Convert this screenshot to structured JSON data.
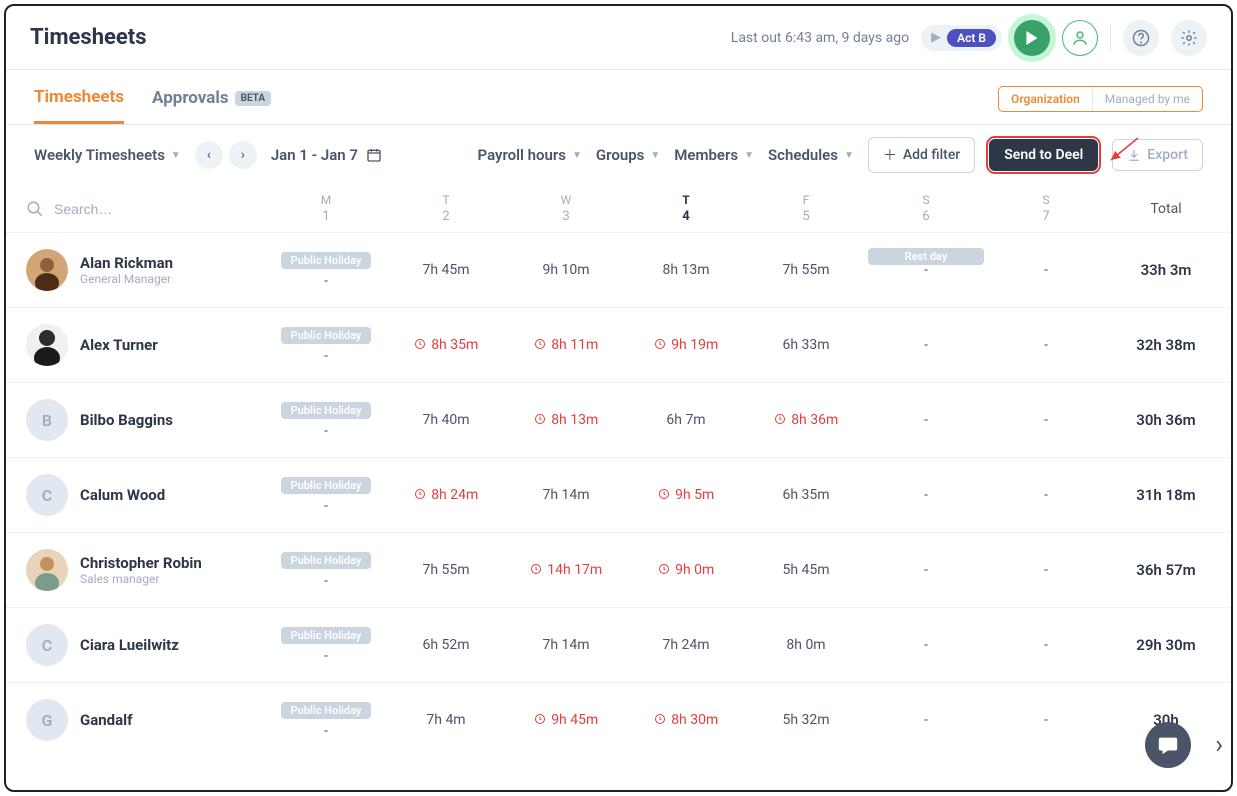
{
  "header": {
    "title": "Timesheets",
    "last_out": "Last out 6:43 am, 9 days ago",
    "act_label": "Act B"
  },
  "tabs": {
    "timesheets": "Timesheets",
    "approvals": "Approvals",
    "beta": "BETA"
  },
  "view_toggle": {
    "org": "Organization",
    "me": "Managed by me"
  },
  "filters": {
    "view": "Weekly Timesheets",
    "date_range": "Jan 1 - Jan 7",
    "payroll": "Payroll hours",
    "groups": "Groups",
    "members": "Members",
    "schedules": "Schedules",
    "add_filter": "Add filter",
    "send_deel": "Send to Deel",
    "export": "Export",
    "search_ph": "Search…"
  },
  "days": [
    {
      "d": "M",
      "n": "1",
      "bold": false
    },
    {
      "d": "T",
      "n": "2",
      "bold": false
    },
    {
      "d": "W",
      "n": "3",
      "bold": false
    },
    {
      "d": "T",
      "n": "4",
      "bold": true
    },
    {
      "d": "F",
      "n": "5",
      "bold": false
    },
    {
      "d": "S",
      "n": "6",
      "bold": false
    },
    {
      "d": "S",
      "n": "7",
      "bold": false
    }
  ],
  "total_label": "Total",
  "holiday_label": "Public Holiday",
  "restday_label": "Rest day",
  "rows": [
    {
      "name": "Alan Rickman",
      "role": "General Manager",
      "avatar": "photo1",
      "cells": [
        {
          "holiday": true,
          "val": "-"
        },
        {
          "val": "7h 45m"
        },
        {
          "val": "9h 10m"
        },
        {
          "val": "8h 13m"
        },
        {
          "val": "7h 55m"
        },
        {
          "rest": true,
          "val": "-"
        },
        {
          "val": "-"
        }
      ],
      "total": "33h 3m"
    },
    {
      "name": "Alex Turner",
      "role": "",
      "avatar": "photo2",
      "cells": [
        {
          "holiday": true,
          "val": "-"
        },
        {
          "val": "8h 35m",
          "warn": true
        },
        {
          "val": "8h 11m",
          "warn": true
        },
        {
          "val": "9h 19m",
          "warn": true
        },
        {
          "val": "6h 33m"
        },
        {
          "val": "-"
        },
        {
          "val": "-"
        }
      ],
      "total": "32h 38m"
    },
    {
      "name": "Bilbo Baggins",
      "role": "",
      "avatar": "B",
      "cells": [
        {
          "holiday": true,
          "val": "-"
        },
        {
          "val": "7h 40m"
        },
        {
          "val": "8h 13m",
          "warn": true
        },
        {
          "val": "6h 7m"
        },
        {
          "val": "8h 36m",
          "warn": true
        },
        {
          "val": "-"
        },
        {
          "val": "-"
        }
      ],
      "total": "30h 36m"
    },
    {
      "name": "Calum Wood",
      "role": "",
      "avatar": "C",
      "cells": [
        {
          "holiday": true,
          "val": "-"
        },
        {
          "val": "8h 24m",
          "warn": true
        },
        {
          "val": "7h 14m"
        },
        {
          "val": "9h 5m",
          "warn": true
        },
        {
          "val": "6h 35m"
        },
        {
          "val": "-"
        },
        {
          "val": "-"
        }
      ],
      "total": "31h 18m"
    },
    {
      "name": "Christopher Robin",
      "role": "Sales manager",
      "avatar": "photo3",
      "cells": [
        {
          "holiday": true,
          "val": "-"
        },
        {
          "val": "7h 55m"
        },
        {
          "val": "14h 17m",
          "warn": true
        },
        {
          "val": "9h 0m",
          "warn": true
        },
        {
          "val": "5h 45m"
        },
        {
          "val": "-"
        },
        {
          "val": "-"
        }
      ],
      "total": "36h 57m"
    },
    {
      "name": "Ciara Lueilwitz",
      "role": "",
      "avatar": "C",
      "cells": [
        {
          "holiday": true,
          "val": "-"
        },
        {
          "val": "6h 52m"
        },
        {
          "val": "7h 14m"
        },
        {
          "val": "7h 24m"
        },
        {
          "val": "8h 0m"
        },
        {
          "val": "-"
        },
        {
          "val": "-"
        }
      ],
      "total": "29h 30m"
    },
    {
      "name": "Gandalf",
      "role": "",
      "avatar": "G",
      "cells": [
        {
          "holiday": true,
          "val": "-"
        },
        {
          "val": "7h 4m"
        },
        {
          "val": "9h 45m",
          "warn": true
        },
        {
          "val": "8h 30m",
          "warn": true
        },
        {
          "val": "5h 32m"
        },
        {
          "val": "-"
        },
        {
          "val": "-"
        }
      ],
      "total": "30h"
    }
  ]
}
